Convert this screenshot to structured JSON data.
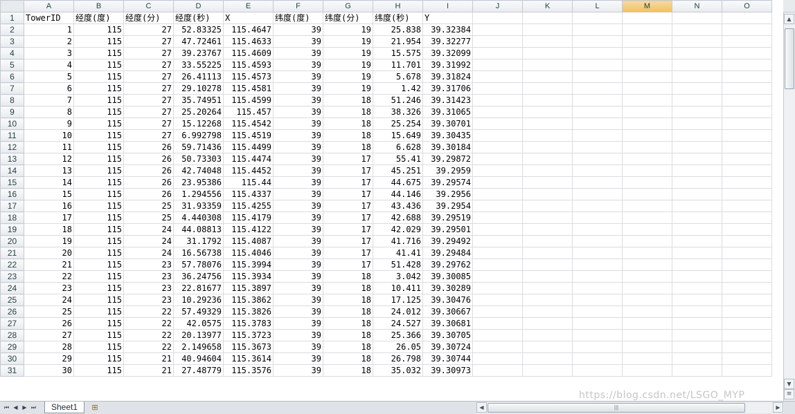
{
  "columns": [
    "A",
    "B",
    "C",
    "D",
    "E",
    "F",
    "G",
    "H",
    "I",
    "J",
    "K",
    "L",
    "M",
    "N",
    "O"
  ],
  "selected_column": "M",
  "header_row": [
    "TowerID",
    "经度(度)",
    "经度(分)",
    "经度(秒)",
    "X",
    "纬度(度)",
    "纬度(分)",
    "纬度(秒)",
    "Y"
  ],
  "rows": [
    [
      "1",
      "115",
      "27",
      "52.83325",
      "115.4647",
      "39",
      "19",
      "25.838",
      "39.32384"
    ],
    [
      "2",
      "115",
      "27",
      "47.72461",
      "115.4633",
      "39",
      "19",
      "21.954",
      "39.32277"
    ],
    [
      "3",
      "115",
      "27",
      "39.23767",
      "115.4609",
      "39",
      "19",
      "15.575",
      "39.32099"
    ],
    [
      "4",
      "115",
      "27",
      "33.55225",
      "115.4593",
      "39",
      "19",
      "11.701",
      "39.31992"
    ],
    [
      "5",
      "115",
      "27",
      "26.41113",
      "115.4573",
      "39",
      "19",
      "5.678",
      "39.31824"
    ],
    [
      "6",
      "115",
      "27",
      "29.10278",
      "115.4581",
      "39",
      "19",
      "1.42",
      "39.31706"
    ],
    [
      "7",
      "115",
      "27",
      "35.74951",
      "115.4599",
      "39",
      "18",
      "51.246",
      "39.31423"
    ],
    [
      "8",
      "115",
      "27",
      "25.20264",
      "115.457",
      "39",
      "18",
      "38.326",
      "39.31065"
    ],
    [
      "9",
      "115",
      "27",
      "15.12268",
      "115.4542",
      "39",
      "18",
      "25.254",
      "39.30701"
    ],
    [
      "10",
      "115",
      "27",
      "6.992798",
      "115.4519",
      "39",
      "18",
      "15.649",
      "39.30435"
    ],
    [
      "11",
      "115",
      "26",
      "59.71436",
      "115.4499",
      "39",
      "18",
      "6.628",
      "39.30184"
    ],
    [
      "12",
      "115",
      "26",
      "50.73303",
      "115.4474",
      "39",
      "17",
      "55.41",
      "39.29872"
    ],
    [
      "13",
      "115",
      "26",
      "42.74048",
      "115.4452",
      "39",
      "17",
      "45.251",
      "39.2959"
    ],
    [
      "14",
      "115",
      "26",
      "23.95386",
      "115.44",
      "39",
      "17",
      "44.675",
      "39.29574"
    ],
    [
      "15",
      "115",
      "26",
      "1.294556",
      "115.4337",
      "39",
      "17",
      "44.146",
      "39.2956"
    ],
    [
      "16",
      "115",
      "25",
      "31.93359",
      "115.4255",
      "39",
      "17",
      "43.436",
      "39.2954"
    ],
    [
      "17",
      "115",
      "25",
      "4.440308",
      "115.4179",
      "39",
      "17",
      "42.688",
      "39.29519"
    ],
    [
      "18",
      "115",
      "24",
      "44.08813",
      "115.4122",
      "39",
      "17",
      "42.029",
      "39.29501"
    ],
    [
      "19",
      "115",
      "24",
      "31.1792",
      "115.4087",
      "39",
      "17",
      "41.716",
      "39.29492"
    ],
    [
      "20",
      "115",
      "24",
      "16.56738",
      "115.4046",
      "39",
      "17",
      "41.41",
      "39.29484"
    ],
    [
      "21",
      "115",
      "23",
      "57.78076",
      "115.3994",
      "39",
      "17",
      "51.428",
      "39.29762"
    ],
    [
      "22",
      "115",
      "23",
      "36.24756",
      "115.3934",
      "39",
      "18",
      "3.042",
      "39.30085"
    ],
    [
      "23",
      "115",
      "23",
      "22.81677",
      "115.3897",
      "39",
      "18",
      "10.411",
      "39.30289"
    ],
    [
      "24",
      "115",
      "23",
      "10.29236",
      "115.3862",
      "39",
      "18",
      "17.125",
      "39.30476"
    ],
    [
      "25",
      "115",
      "22",
      "57.49329",
      "115.3826",
      "39",
      "18",
      "24.012",
      "39.30667"
    ],
    [
      "26",
      "115",
      "22",
      "42.0575",
      "115.3783",
      "39",
      "18",
      "24.527",
      "39.30681"
    ],
    [
      "27",
      "115",
      "22",
      "20.13977",
      "115.3723",
      "39",
      "18",
      "25.366",
      "39.30705"
    ],
    [
      "28",
      "115",
      "22",
      "2.149658",
      "115.3673",
      "39",
      "18",
      "26.05",
      "39.30724"
    ],
    [
      "29",
      "115",
      "21",
      "40.94604",
      "115.3614",
      "39",
      "18",
      "26.798",
      "39.30744"
    ],
    [
      "30",
      "115",
      "21",
      "27.48779",
      "115.3576",
      "39",
      "18",
      "35.032",
      "39.30973"
    ]
  ],
  "sheet_tab": "Sheet1",
  "watermark": "https://blog.csdn.net/LSGO_MYP"
}
